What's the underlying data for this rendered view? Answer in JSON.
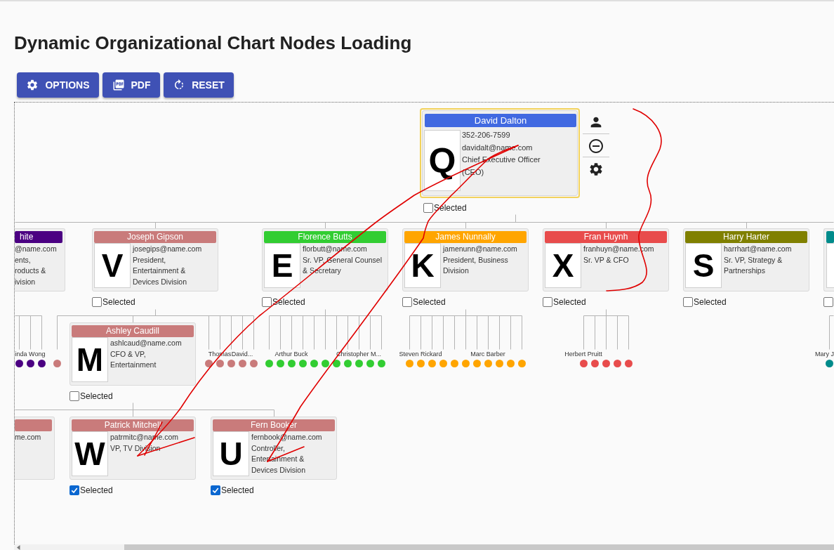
{
  "page": {
    "title": "Dynamic Organizational Chart Nodes Loading"
  },
  "toolbar": [
    {
      "kind": "options",
      "label": "OPTIONS"
    },
    {
      "kind": "pdf",
      "label": "PDF"
    },
    {
      "kind": "reset",
      "label": "RESET"
    }
  ],
  "org_chart": {
    "root": {
      "kind": "card",
      "name": "David Dalton",
      "color": "#4169e1",
      "initial": "Q",
      "lines": [
        "352-206-7599",
        "davidalt@name.com",
        "Chief Executive Officer",
        "(CEO)"
      ],
      "highlighted": true,
      "checkbox": {
        "label": "Selected",
        "checked": false
      },
      "children": [
        {
          "kind": "clipped_card",
          "name": "hite",
          "color": "#4b0082",
          "lines": [
            "@name.com",
            "ents,",
            "roducts &",
            "ivision"
          ],
          "children": [
            {
              "kind": "dot",
              "color": "#4b0082"
            },
            {
              "kind": "dot",
              "color": "#4b0082",
              "label": "inda Wong"
            },
            {
              "kind": "dot",
              "color": "#4b0082"
            }
          ]
        },
        {
          "kind": "card",
          "name": "Joseph Gipson",
          "color": "#c97b7b",
          "initial": "V",
          "lines": [
            "josegips@name.com",
            "President,",
            "Entertainment &",
            "Devices Division"
          ],
          "checkbox": {
            "label": "Selected",
            "checked": false
          },
          "children": [
            {
              "kind": "dot",
              "color": "#c97b7b"
            },
            {
              "kind": "card",
              "name": "Ashley Caudill",
              "color": "#c97b7b",
              "initial": "M",
              "lines": [
                "ashlcaud@name.com",
                "CFO & VP,",
                "Entertainment"
              ],
              "checkbox": {
                "label": "Selected",
                "checked": false
              },
              "children": [
                {
                  "kind": "clipped_card",
                  "color": "#c97b7b",
                  "lines": [
                    "me.com"
                  ]
                },
                {
                  "kind": "card",
                  "name": "Patrick Mitchell",
                  "color": "#c97b7b",
                  "initial": "W",
                  "lines": [
                    "patrmitc@name.com",
                    "VP, TV Division"
                  ],
                  "checkbox": {
                    "label": "Selected",
                    "checked": true
                  }
                },
                {
                  "kind": "card",
                  "name": "Fern Booker",
                  "color": "#c97b7b",
                  "initial": "U",
                  "lines": [
                    "fernbook@name.com",
                    "Controller,",
                    "Entertainment &",
                    "Devices Division"
                  ],
                  "checkbox": {
                    "label": "Selected",
                    "checked": true
                  }
                }
              ]
            },
            {
              "kind": "dot",
              "color": "#c97b7b"
            },
            {
              "kind": "dot",
              "color": "#c97b7b",
              "label": "Thomas"
            },
            {
              "kind": "dot",
              "color": "#c97b7b"
            },
            {
              "kind": "dot",
              "color": "#c97b7b",
              "label": "David..."
            },
            {
              "kind": "dot",
              "color": "#c97b7b"
            }
          ]
        },
        {
          "kind": "card",
          "name": "Florence Butts",
          "color": "#32cd32",
          "initial": "E",
          "lines": [
            "florbutt@name.com",
            "Sr. VP, General Counsel",
            "& Secretary"
          ],
          "checkbox": {
            "label": "Selected",
            "checked": false
          },
          "children": [
            {
              "kind": "dot",
              "color": "#32cd32"
            },
            {
              "kind": "dot",
              "color": "#32cd32"
            },
            {
              "kind": "dot",
              "color": "#32cd32",
              "label": "Arthur Buck"
            },
            {
              "kind": "dot",
              "color": "#32cd32"
            },
            {
              "kind": "dot",
              "color": "#32cd32"
            },
            {
              "kind": "dot",
              "color": "#32cd32"
            },
            {
              "kind": "dot",
              "color": "#32cd32"
            },
            {
              "kind": "dot",
              "color": "#32cd32"
            },
            {
              "kind": "dot",
              "color": "#32cd32",
              "label": "Christopher M..."
            },
            {
              "kind": "dot",
              "color": "#32cd32"
            },
            {
              "kind": "dot",
              "color": "#32cd32"
            }
          ]
        },
        {
          "kind": "card",
          "name": "James Nunnally",
          "color": "#ffa500",
          "initial": "K",
          "lines": [
            "jamenunn@name.com",
            "President, Business",
            "Division"
          ],
          "checkbox": {
            "label": "Selected",
            "checked": false
          },
          "children": [
            {
              "kind": "dot",
              "color": "#ffa500"
            },
            {
              "kind": "dot",
              "color": "#ffa500",
              "label": "Steven Rickard"
            },
            {
              "kind": "dot",
              "color": "#ffa500"
            },
            {
              "kind": "dot",
              "color": "#ffa500"
            },
            {
              "kind": "dot",
              "color": "#ffa500"
            },
            {
              "kind": "dot",
              "color": "#ffa500"
            },
            {
              "kind": "dot",
              "color": "#ffa500"
            },
            {
              "kind": "dot",
              "color": "#ffa500",
              "label": "Marc Barber"
            },
            {
              "kind": "dot",
              "color": "#ffa500"
            },
            {
              "kind": "dot",
              "color": "#ffa500"
            },
            {
              "kind": "dot",
              "color": "#ffa500"
            }
          ]
        },
        {
          "kind": "card",
          "name": "Fran Huynh",
          "color": "#e84c4c",
          "initial": "X",
          "lines": [
            "franhuyn@name.com",
            "Sr. VP & CFO"
          ],
          "checkbox": {
            "label": "Selected",
            "checked": false
          },
          "children": [
            {
              "kind": "dot",
              "color": "#e84c4c",
              "label": "Herbert Pruitt"
            },
            {
              "kind": "dot",
              "color": "#e84c4c"
            },
            {
              "kind": "dot",
              "color": "#e84c4c"
            },
            {
              "kind": "dot",
              "color": "#e84c4c"
            },
            {
              "kind": "dot",
              "color": "#e84c4c"
            }
          ]
        },
        {
          "kind": "card",
          "name": "Harry Harter",
          "color": "#808000",
          "initial": "S",
          "lines": [
            "harrhart@name.com",
            "Sr. VP, Strategy &",
            "Partnerships"
          ],
          "checkbox": {
            "label": "Selected",
            "checked": false
          }
        },
        {
          "kind": "clipped_card",
          "color": "#008b8b",
          "checkbox": {
            "checked": false
          },
          "children": [
            {
              "kind": "dot",
              "color": "#008b8b",
              "label": "Mary J"
            }
          ]
        }
      ]
    }
  }
}
